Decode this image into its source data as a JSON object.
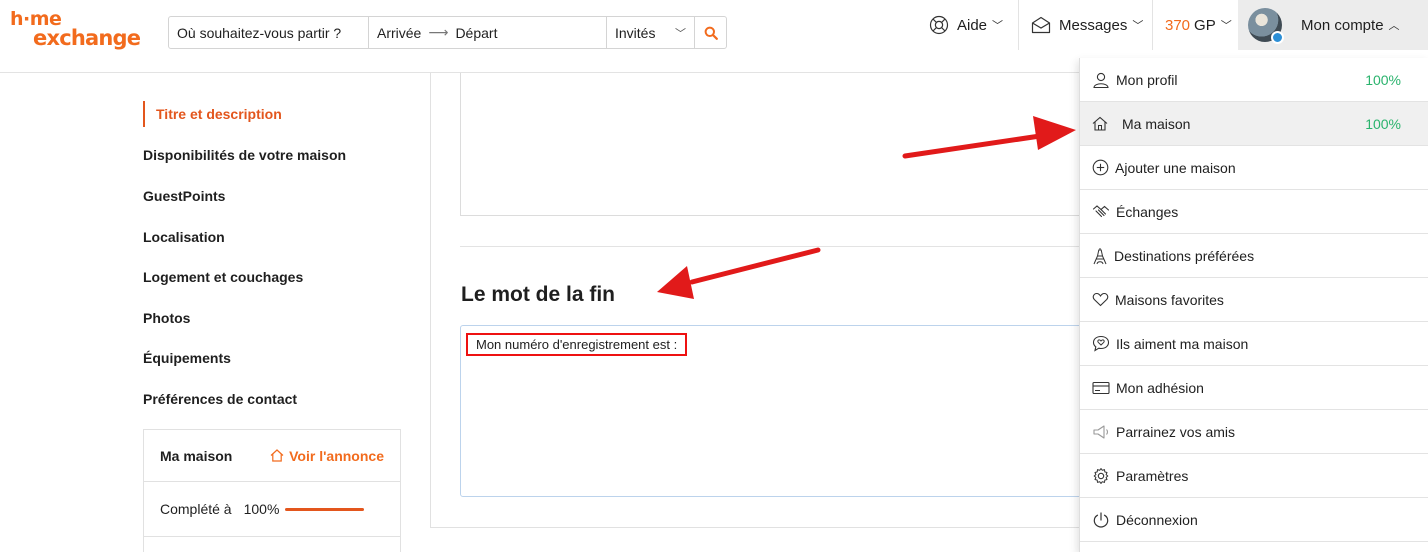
{
  "header": {
    "logo_line1": "h·me",
    "logo_line2": "exchange",
    "search": {
      "destination_placeholder": "Où souhaitez-vous partir ?",
      "arrival_label": "Arrivée",
      "departure_label": "Départ",
      "guests_label": "Invités"
    },
    "help_label": "Aide",
    "messages_label": "Messages",
    "gp_value": "370",
    "gp_unit": "GP",
    "account_label": "Mon compte"
  },
  "sidebar": {
    "items": [
      "Titre et description",
      "Disponibilités de votre maison",
      "GuestPoints",
      "Localisation",
      "Logement et couchages",
      "Photos",
      "Équipements",
      "Préférences de contact"
    ],
    "card": {
      "title": "Ma maison",
      "link_label": "Voir l'annonce",
      "completion_label": "Complété à",
      "completion_value": "100%",
      "completion_fraction": 1.0
    }
  },
  "main": {
    "section_title": "Le mot de la fin",
    "textarea_value": "Mon numéro d'enregistrement est :"
  },
  "dropdown": {
    "items": [
      {
        "label": "Mon profil",
        "badge": "100%",
        "icon": "user-icon"
      },
      {
        "label": "Ma maison",
        "badge": "100%",
        "icon": "house-icon"
      },
      {
        "label": "Ajouter une maison",
        "icon": "plus-circle-icon"
      },
      {
        "label": "Échanges",
        "icon": "handshake-icon"
      },
      {
        "label": "Destinations préférées",
        "icon": "eiffel-tower-icon"
      },
      {
        "label": "Maisons favorites",
        "icon": "heart-icon"
      },
      {
        "label": "Ils aiment ma maison",
        "icon": "chat-heart-icon"
      },
      {
        "label": "Mon adhésion",
        "icon": "card-icon"
      },
      {
        "label": "Parrainez vos amis",
        "icon": "megaphone-icon"
      },
      {
        "label": "Paramètres",
        "icon": "gear-icon"
      },
      {
        "label": "Déconnexion",
        "icon": "power-icon"
      }
    ]
  },
  "colors": {
    "brand_orange": "#f26b1d",
    "active_red_orange": "#e3561d",
    "success_green": "#2ab36d",
    "annotation_red": "#e11a1a"
  }
}
